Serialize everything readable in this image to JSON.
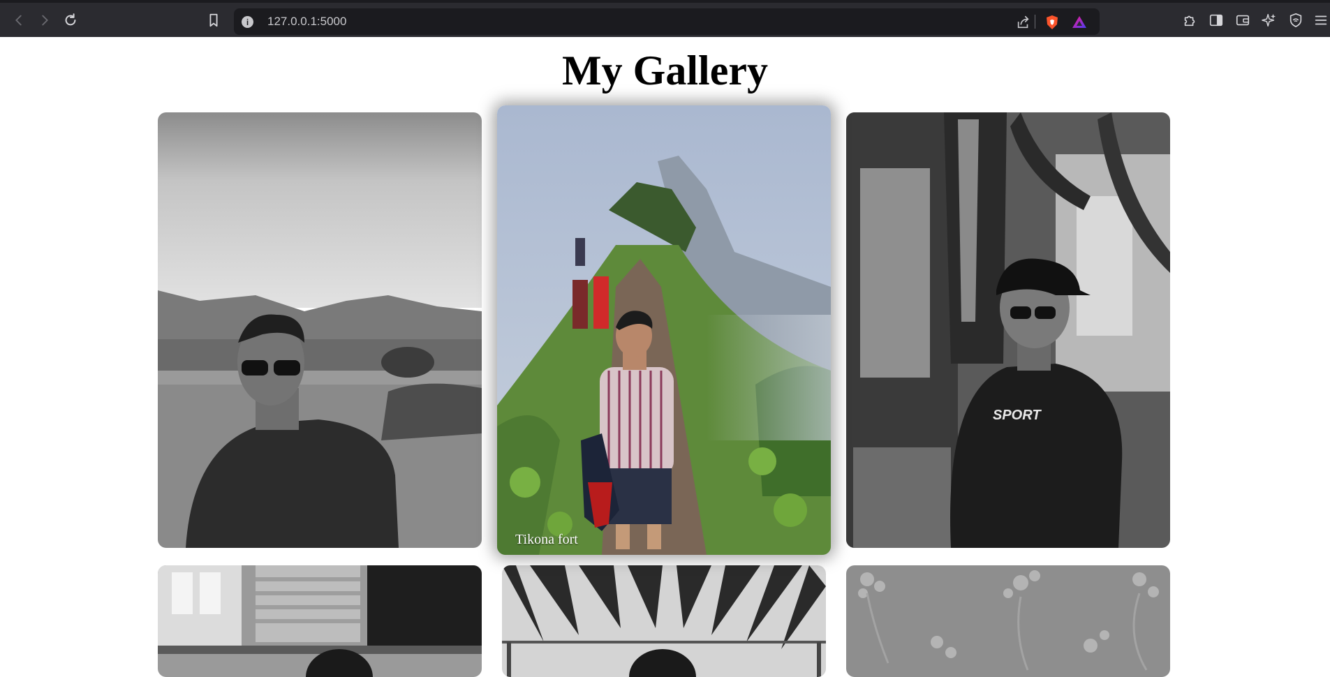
{
  "browser": {
    "url": "127.0.0.1:5000",
    "icons": [
      "back-icon",
      "forward-icon",
      "reload-icon",
      "bookmark-icon",
      "site-info-icon",
      "share-icon",
      "brave-shields-icon",
      "brave-rewards-icon",
      "extensions-icon",
      "sidebar-icon",
      "wallet-icon",
      "leo-ai-icon",
      "vpn-icon",
      "menu-icon"
    ]
  },
  "gallery": {
    "title": "My Gallery",
    "photos": [
      {
        "caption": "",
        "style": "grayscale"
      },
      {
        "caption": "Tikona fort",
        "style": "color",
        "state": "hovered"
      },
      {
        "caption": "",
        "style": "grayscale"
      },
      {
        "caption": "",
        "style": "grayscale"
      },
      {
        "caption": "",
        "style": "grayscale"
      },
      {
        "caption": "",
        "style": "grayscale"
      }
    ]
  }
}
